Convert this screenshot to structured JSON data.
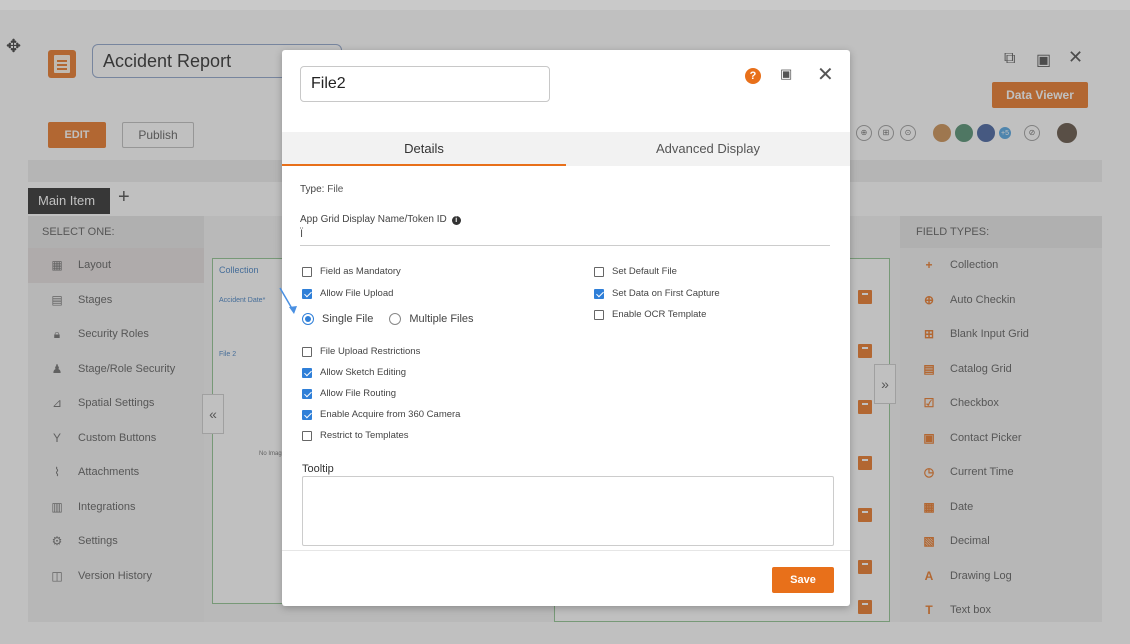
{
  "app": {
    "title": "Accident Report",
    "edit_label": "EDIT",
    "publish_label": "Publish",
    "data_viewer_label": "Data Viewer",
    "main_tab_label": "Main Item",
    "avatar_badge": "+5"
  },
  "sidebar": {
    "header": "SELECT ONE:",
    "items": [
      {
        "label": "Layout",
        "icon": "layout-icon"
      },
      {
        "label": "Stages",
        "icon": "stages-icon"
      },
      {
        "label": "Security Roles",
        "icon": "lock-icon"
      },
      {
        "label": "Stage/Role Security",
        "icon": "users-icon"
      },
      {
        "label": "Spatial Settings",
        "icon": "spatial-icon"
      },
      {
        "label": "Custom Buttons",
        "icon": "custom-buttons-icon"
      },
      {
        "label": "Attachments",
        "icon": "paperclip-icon"
      },
      {
        "label": "Integrations",
        "icon": "integrations-icon"
      },
      {
        "label": "Settings",
        "icon": "gear-icon"
      },
      {
        "label": "Version History",
        "icon": "history-icon"
      }
    ]
  },
  "canvas": {
    "collection_label": "Collection",
    "accident_date_label": "Accident Date*",
    "file2_label": "File 2",
    "no_image_label": "No Imag"
  },
  "field_types": {
    "header": "FIELD TYPES:",
    "items": [
      {
        "label": "Collection",
        "icon": "plus-icon"
      },
      {
        "label": "Auto Checkin",
        "icon": "crosshair-icon"
      },
      {
        "label": "Blank Input Grid",
        "icon": "grid-icon"
      },
      {
        "label": "Catalog Grid",
        "icon": "catalog-icon"
      },
      {
        "label": "Checkbox",
        "icon": "checkbox-icon"
      },
      {
        "label": "Contact Picker",
        "icon": "contact-icon"
      },
      {
        "label": "Current Time",
        "icon": "clock-icon"
      },
      {
        "label": "Date",
        "icon": "calendar-icon"
      },
      {
        "label": "Decimal",
        "icon": "decimal-icon"
      },
      {
        "label": "Drawing Log",
        "icon": "drawing-icon"
      },
      {
        "label": "Text box",
        "icon": "textbox-icon"
      }
    ]
  },
  "modal": {
    "name_value": "File2",
    "tabs": [
      {
        "label": "Details",
        "active": true
      },
      {
        "label": "Advanced Display",
        "active": false
      }
    ],
    "type_label": "Type:",
    "type_value": "File",
    "token_label": "App Grid Display Name/Token ID",
    "token_value": "Ï",
    "left_options": [
      {
        "label": "Field as Mandatory",
        "checked": false
      },
      {
        "label": "Allow File Upload",
        "checked": true
      }
    ],
    "radio_options": [
      {
        "label": "Single File",
        "selected": true
      },
      {
        "label": "Multiple Files",
        "selected": false
      }
    ],
    "left_options2": [
      {
        "label": "File Upload Restrictions",
        "checked": false
      },
      {
        "label": "Allow Sketch Editing",
        "checked": true
      },
      {
        "label": "Allow File Routing",
        "checked": true
      },
      {
        "label": "Enable Acquire from 360 Camera",
        "checked": true
      },
      {
        "label": "Restrict to Templates",
        "checked": false
      }
    ],
    "right_options": [
      {
        "label": "Set Default File",
        "checked": false
      },
      {
        "label": "Set Data on First Capture",
        "checked": true
      },
      {
        "label": "Enable OCR Template",
        "checked": false
      }
    ],
    "tooltip_label": "Tooltip",
    "tooltip_value": "",
    "save_label": "Save"
  },
  "colors": {
    "accent": "#e8701a",
    "check_blue": "#2f7fd8"
  }
}
